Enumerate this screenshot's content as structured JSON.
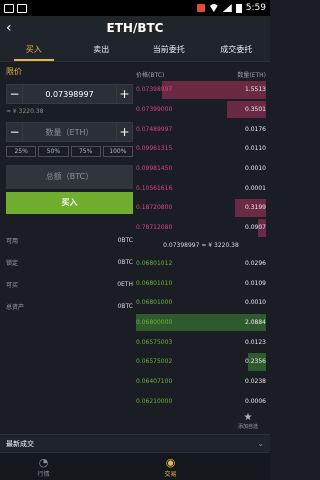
{
  "status": {
    "time": "5:59"
  },
  "header": {
    "title": "ETH/BTC"
  },
  "tabs": [
    "买入",
    "卖出",
    "当前委托",
    "成交委托"
  ],
  "order_form": {
    "type_label": "限价",
    "price_value": "0.07398997",
    "approx": "≈ ¥ 3220.38",
    "amount_placeholder": "数量（ETH）",
    "percent_options": [
      "25%",
      "50%",
      "75%",
      "100%"
    ],
    "total_placeholder": "总额（BTC）",
    "buy_label": "买入"
  },
  "balances": [
    {
      "label": "可用",
      "value": "0BTC"
    },
    {
      "label": "锁定",
      "value": "0BTC"
    },
    {
      "label": "可买",
      "value": "0ETH"
    },
    {
      "label": "总资产",
      "value": "0BTC"
    }
  ],
  "orderbook": {
    "price_header": "价格(BTC)",
    "qty_header": "数量(ETH)",
    "asks": [
      {
        "price": "0.07398997",
        "qty": "1.5513",
        "depth": 0.8
      },
      {
        "price": "0.07399000",
        "qty": "0.3501",
        "depth": 0.3
      },
      {
        "price": "0.07489997",
        "qty": "0.0176",
        "depth": 0
      },
      {
        "price": "0.09961315",
        "qty": "0.0110",
        "depth": 0
      },
      {
        "price": "0.09981450",
        "qty": "0.0010",
        "depth": 0
      },
      {
        "price": "0.10561616",
        "qty": "0.0001",
        "depth": 0
      },
      {
        "price": "0.18720800",
        "qty": "0.3199",
        "depth": 0.24
      },
      {
        "price": "0.78712080",
        "qty": "0.0907",
        "depth": 0.06
      }
    ],
    "mid": "0.07398997 ≈ ¥ 3220.38",
    "bids": [
      {
        "price": "0.06801012",
        "qty": "0.0296",
        "depth": 0
      },
      {
        "price": "0.06801010",
        "qty": "0.0109",
        "depth": 0
      },
      {
        "price": "0.06801000",
        "qty": "0.0010",
        "depth": 0
      },
      {
        "price": "0.06800000",
        "qty": "2.0884",
        "depth": 1.0
      },
      {
        "price": "0.06575003",
        "qty": "0.0123",
        "depth": 0
      },
      {
        "price": "0.06575002",
        "qty": "0.2356",
        "depth": 0.14
      },
      {
        "price": "0.06407100",
        "qty": "0.0238",
        "depth": 0
      },
      {
        "price": "0.06210000",
        "qty": "0.0006",
        "depth": 0
      }
    ],
    "favorite_label": "添加自选"
  },
  "recent_trades_label": "最新成交",
  "nav": [
    {
      "label": "行情",
      "icon": "chart-icon"
    },
    {
      "label": "交易",
      "icon": "trade-icon"
    }
  ]
}
